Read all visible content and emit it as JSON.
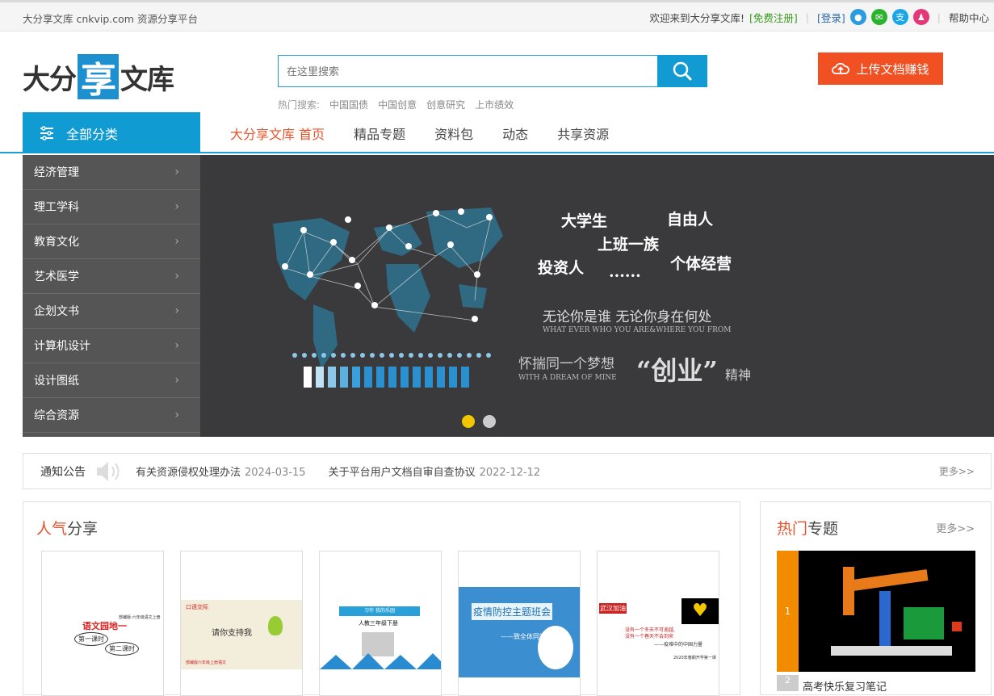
{
  "topbar": {
    "left_text": "大分享文库 cnkvip.com 资源分享平台",
    "welcome": "欢迎来到大分享文库!",
    "register": "[免费注册]",
    "login": "[登录]",
    "help": "帮助中心",
    "social_icons": [
      "weibo-icon",
      "wechat-icon",
      "alipay-icon",
      "qq-icon"
    ]
  },
  "logo": {
    "part1": "大分",
    "part2": "享",
    "part3": "文库"
  },
  "search": {
    "placeholder": "在这里搜索",
    "hot_label": "热门搜索:",
    "hot_terms": [
      "中国国债",
      "中国创意",
      "创意研究",
      "上市绩效"
    ]
  },
  "upload": {
    "label": "上传文档赚钱"
  },
  "nav": {
    "all_categories": "全部分类",
    "items": [
      "大分享文库 首页",
      "精品专题",
      "资料包",
      "动态",
      "共享资源"
    ]
  },
  "sidebar": {
    "items": [
      "经济管理",
      "理工学科",
      "教育文化",
      "艺术医学",
      "企划文书",
      "计算机设计",
      "设计图纸",
      "综合资源"
    ]
  },
  "banner": {
    "words": [
      "大学生",
      "自由人",
      "上班一族",
      "投资人",
      "个体经营",
      "······"
    ],
    "line1": "无论你是谁 无论你身在何处",
    "line1_en": "WHAT EVER WHO YOU ARE&WHERE YOU FROM",
    "line2": "怀揣同一个梦想",
    "line2_en": "WITH A DREAM OF MINE",
    "chuangye": "“创业”",
    "jingshen": "精神",
    "slides": 2,
    "active_slide": 1
  },
  "notice": {
    "title": "通知公告",
    "items": [
      {
        "text": "有关资源侵权处理办法",
        "date": "2024-03-15"
      },
      {
        "text": "关于平台用户文档自审自查协议",
        "date": "2022-12-12"
      }
    ],
    "more": "更多>>"
  },
  "popular": {
    "title_red": "人气",
    "title_rest": "分享",
    "cards": [
      {
        "thumb_text": "语文园地一",
        "sub1": "第一课时",
        "sub2": "第二课时",
        "tiny": "部编版·六年级语文上册"
      },
      {
        "thumb_text": "请你支持我",
        "tag": "口语交际",
        "tiny": "部编版六年级上册语文"
      },
      {
        "thumb_text": "人教三年级下册",
        "tag": "习作 我的乐园"
      },
      {
        "thumb_text": "疫情防控主题班会",
        "sub1": "——致全体同学"
      },
      {
        "thumb_text": "武汉加油",
        "line1": "没有一个冬天不可逾越,",
        "line2": "没有一个春天不会到来",
        "line3": "——疫难中的中国力量",
        "tiny": "2020年春期开学第一课"
      }
    ]
  },
  "topics": {
    "title_red": "热门",
    "title_rest": "专题",
    "more": "更多>>",
    "items": [
      {
        "rank": "1"
      },
      {
        "rank": "2",
        "title": "高考快乐复习笔记"
      }
    ]
  }
}
